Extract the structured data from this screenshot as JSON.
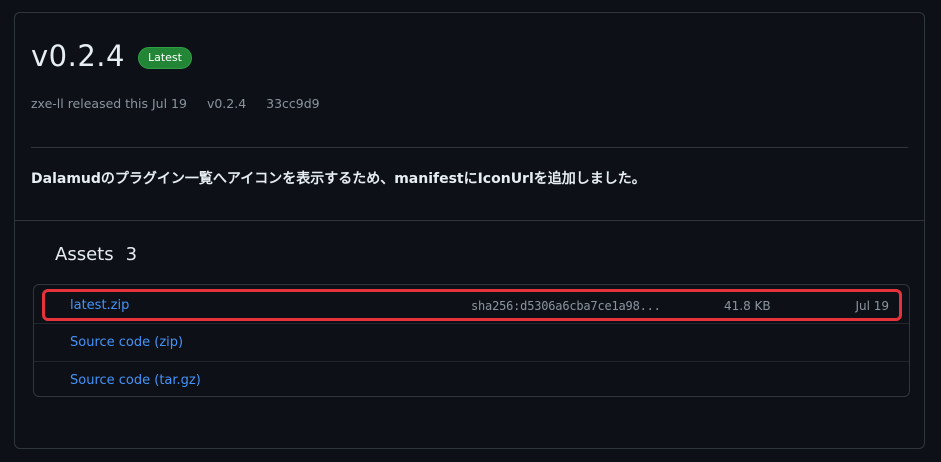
{
  "release": {
    "version": "v0.2.4",
    "badge": "Latest",
    "meta": {
      "released_by": "zxe-ll released this Jul 19",
      "tag": "v0.2.4",
      "commit": "33cc9d9"
    },
    "notes": "Dalamudのプラグイン一覧へアイコンを表示するため、manifestにIconUrlを追加しました。"
  },
  "assets": {
    "heading": "Assets",
    "count": "3",
    "items": [
      {
        "name": "latest.zip",
        "sha": "sha256:d5306a6cba7ce1a98...",
        "size": "41.8 KB",
        "date": "Jul 19",
        "highlighted": true
      },
      {
        "name": "Source code (zip)"
      },
      {
        "name": "Source code (tar.gz)"
      }
    ]
  },
  "colors": {
    "background": "#0d1117",
    "border": "#30363d",
    "link": "#4493f8",
    "badge_green": "#238636",
    "highlight": "#e5323b",
    "muted": "#8b949e"
  }
}
